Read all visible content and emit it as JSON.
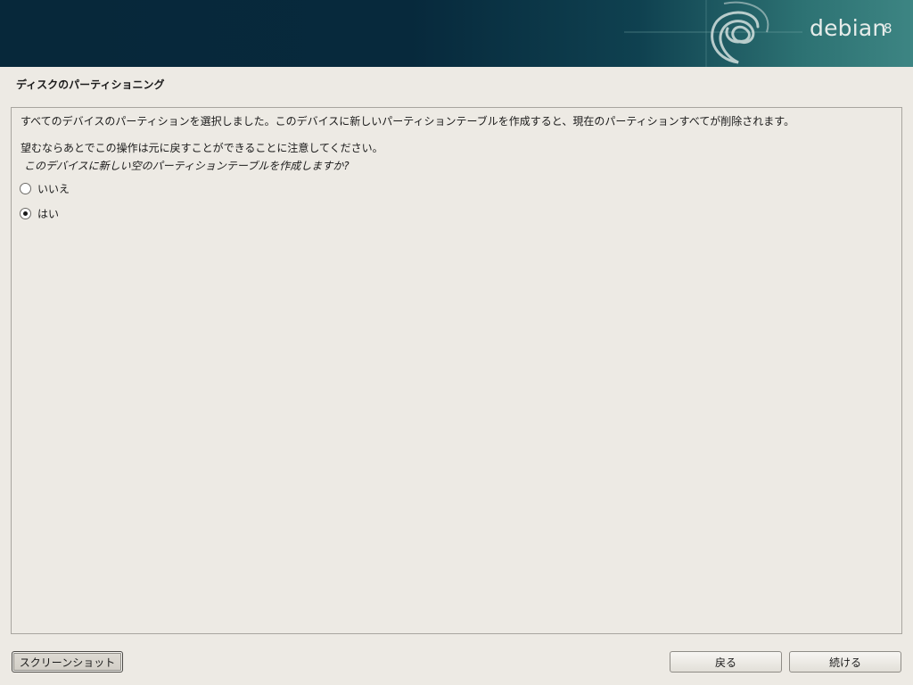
{
  "header": {
    "logo_text": "debian",
    "logo_version": "8",
    "colors": {
      "banner_dark": "#07283a",
      "banner_light": "#3d8583"
    }
  },
  "step": {
    "title": "ディスクのパーティショニング"
  },
  "dialog": {
    "message_line1": "すべてのデバイスのパーティションを選択しました。このデバイスに新しいパーティションテーブルを作成すると、現在のパーティションすべてが削除されます。",
    "message_line2": "望むならあとでこの操作は元に戻すことができることに注意してください。",
    "question": "このデバイスに新しい空のパーティションテーブルを作成しますか?",
    "options": [
      {
        "label": "いいえ",
        "selected": false
      },
      {
        "label": "はい",
        "selected": true
      }
    ]
  },
  "buttons": {
    "screenshot": "スクリーンショット",
    "back": "戻る",
    "continue": "続ける"
  }
}
